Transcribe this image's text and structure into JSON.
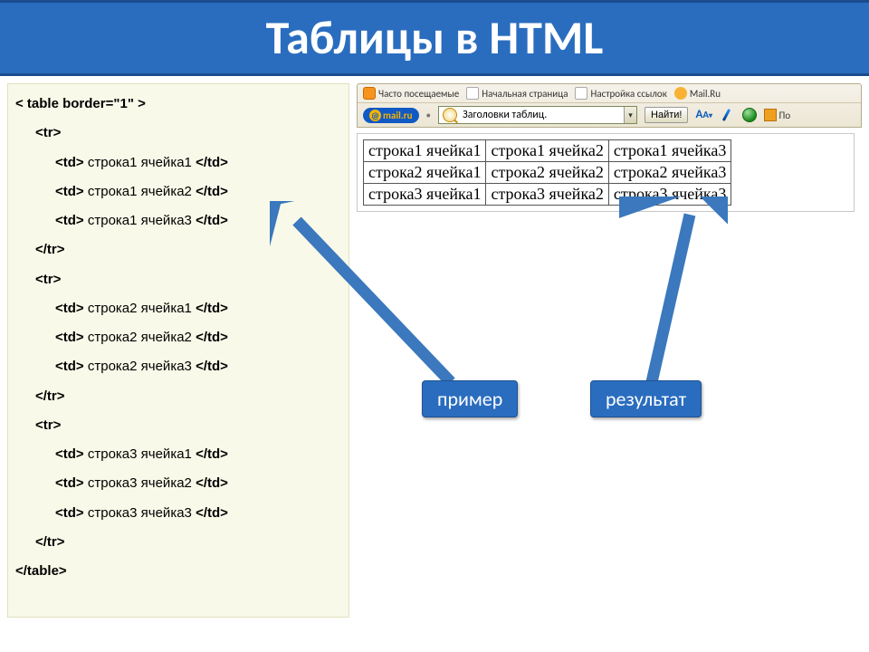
{
  "title": "Таблицы в HTML",
  "code": {
    "open": "< table border=\"1\" >",
    "tr_open": "<tr>",
    "tr_close": "</tr>",
    "close": "</table>",
    "rows": [
      [
        "<td> строка1 ячейка1 </td>",
        "<td> строка1 ячейка2 </td>",
        "<td> строка1 ячейка3 </td>"
      ],
      [
        "<td> строка2 ячейка1 </td>",
        "<td> строка2 ячейка2 </td>",
        "<td> строка2 ячейка3 </td>"
      ],
      [
        "<td> строка3 ячейка1 </td>",
        "<td> строка3 ячейка2 </td>",
        "<td> строка3 ячейка3 </td>"
      ]
    ]
  },
  "toolbar": {
    "freq_visited": "Часто посещаемые",
    "home_page": "Начальная страница",
    "link_settings": "Настройка ссылок",
    "mailru_link": "Mail.Ru",
    "mailru_badge": "mail.ru",
    "search_value": "Заголовки таблиц.",
    "find_label": "Найти!",
    "po_cut": "По"
  },
  "table": {
    "rows": [
      [
        "строка1 ячейка1",
        "строка1 ячейка2",
        "строка1 ячейка3"
      ],
      [
        "строка2 ячейка1",
        "строка2 ячейка2",
        "строка2 ячейка3"
      ],
      [
        "строка3 ячейка1",
        "строка3 ячейка2",
        "строка3 ячейка3"
      ]
    ]
  },
  "callouts": {
    "example": "пример",
    "result": "результат"
  }
}
